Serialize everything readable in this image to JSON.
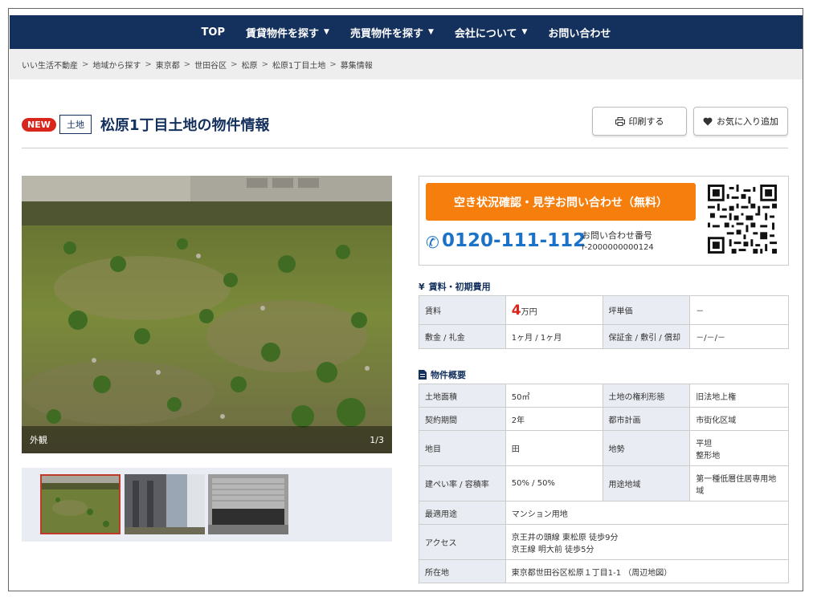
{
  "nav": {
    "items": [
      {
        "label": "TOP",
        "has_menu": false
      },
      {
        "label": "賃貸物件を探す",
        "has_menu": true
      },
      {
        "label": "売買物件を探す",
        "has_menu": true
      },
      {
        "label": "会社について",
        "has_menu": true
      },
      {
        "label": "お問い合わせ",
        "has_menu": false
      }
    ]
  },
  "breadcrumb": [
    "いい生活不動産",
    "地域から探す",
    "東京都",
    "世田谷区",
    "松原",
    "松原1丁目土地",
    "募集情報"
  ],
  "title": {
    "new_badge": "NEW",
    "type_badge": "土地",
    "text": "松原1丁目土地の物件情報",
    "print_label": "印刷する",
    "fav_label": "お気に入り追加"
  },
  "photo": {
    "caption": "外観",
    "counter": "1/3",
    "thumb_count": 3,
    "active_thumb": 1
  },
  "contact": {
    "button_label": "空き状況確認・見学お問い合わせ（無料）",
    "phone": "0120-111-112",
    "inquiry_label": "お問い合わせ番号",
    "inquiry_id": "r-2000000000124"
  },
  "fees": {
    "heading": "賃料・初期費用",
    "rent_label": "賃料",
    "rent_value": "4",
    "rent_unit": "万円",
    "tsubo_label": "坪単価",
    "tsubo_value": "－",
    "deposit_label": "敷金 / 礼金",
    "deposit_value": "1ヶ月 / 1ヶ月",
    "guarantee_label": "保証金 / 敷引 / 償却",
    "guarantee_value": "－/－/－"
  },
  "overview": {
    "heading": "物件概要",
    "land_area_label": "土地面積",
    "land_area_value": "50㎡",
    "right_label": "土地の権利形態",
    "right_value": "旧法地上権",
    "term_label": "契約期間",
    "term_value": "2年",
    "city_plan_label": "都市計画",
    "city_plan_value": "市街化区域",
    "chimoku_label": "地目",
    "chimoku_value": "田",
    "terrain_label": "地勢",
    "terrain_value_1": "平坦",
    "terrain_value_2": "整形地",
    "ratio_label": "建ぺい率 / 容積率",
    "ratio_value": "50% / 50%",
    "zone_label": "用途地域",
    "zone_value": "第一種低層住居専用地域",
    "best_use_label": "最適用途",
    "best_use_value": "マンション用地",
    "access_label": "アクセス",
    "access_1": "京王井の頭線 東松原 徒歩9分",
    "access_2": "京王線 明大前 徒歩5分",
    "address_label": "所在地",
    "address_value": "東京都世田谷区松原１丁目1-1",
    "map_link": "（周辺地図）"
  },
  "colors": {
    "navy": "#14315e",
    "orange": "#f67e0c",
    "phone_blue": "#1b72c7",
    "red": "#d9261c"
  }
}
